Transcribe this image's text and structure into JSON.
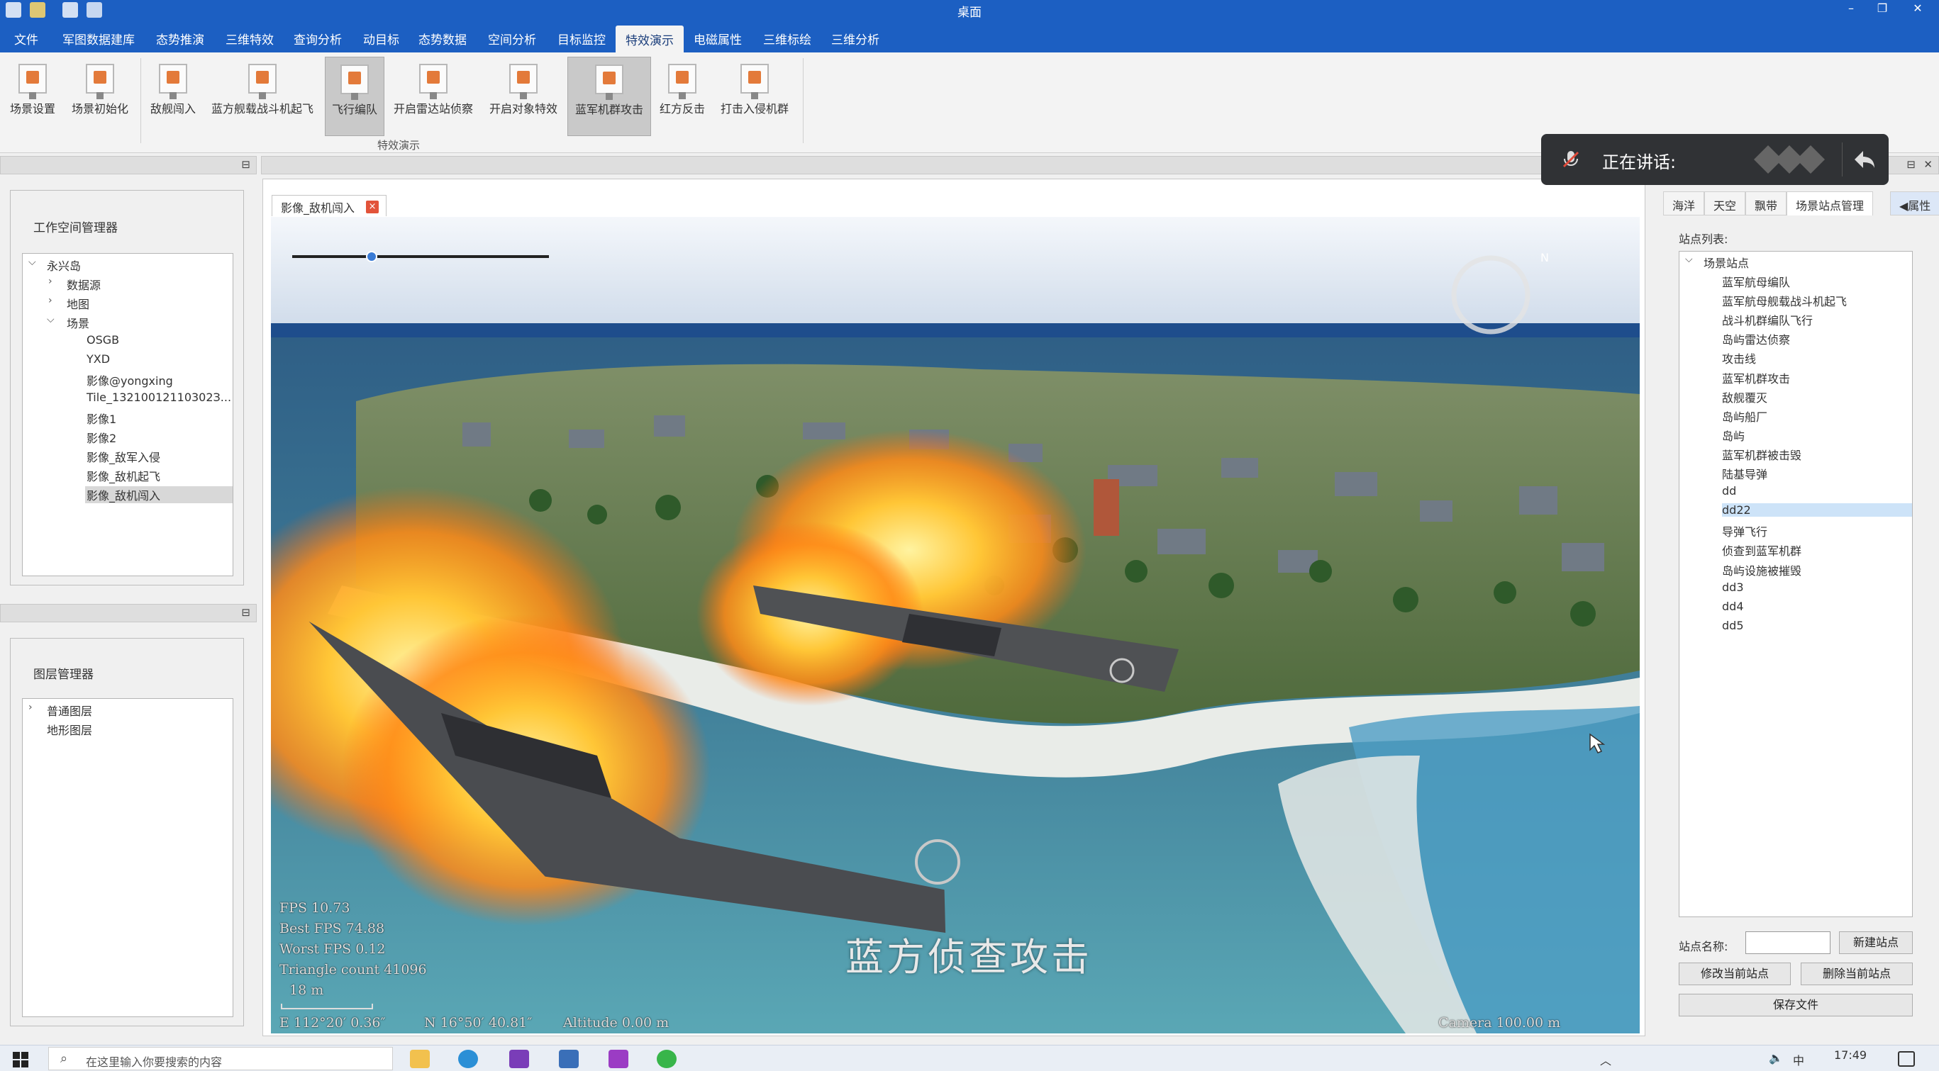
{
  "window": {
    "title": "桌面"
  },
  "menu": {
    "items": [
      "文件",
      "军图数据建库",
      "态势推演",
      "三维特效",
      "查询分析",
      "动目标",
      "态势数据",
      "空间分析",
      "目标监控",
      "特效演示",
      "电磁属性",
      "三维标绘",
      "三维分析"
    ],
    "active": "特效演示"
  },
  "ribbon": {
    "buttons": [
      "场景设置",
      "场景初始化",
      "敌舰闯入",
      "蓝方舰载战斗机起飞",
      "飞行编队",
      "开启雷达站侦察",
      "开启对象特效",
      "蓝军机群攻击",
      "红方反击",
      "打击入侵机群"
    ],
    "group_label": "特效演示"
  },
  "workspace": {
    "title": "工作空间管理器",
    "root": "永兴岛",
    "nodes": [
      "数据源",
      "地图",
      "场景"
    ],
    "scene_children": [
      "OSGB",
      "YXD",
      "影像@yongxing",
      "Tile_13210012110302З...",
      "影像1",
      "影像2",
      "影像_敌军入侵",
      "影像_敌机起飞",
      "影像_敌机闯入"
    ]
  },
  "layers": {
    "title": "图层管理器",
    "nodes": [
      "普通图层",
      "地形图层"
    ]
  },
  "document": {
    "tab_label": "影像_敌机闯入",
    "close_label": "×"
  },
  "scene": {
    "caption": "蓝方侦查攻击",
    "slider_fraction": 0.31,
    "fps": "FPS    10.73",
    "best_fps": "Best FPS   74.88",
    "worst_fps": "Worst FPS   0.12",
    "triangles": "Triangle count  41096",
    "scale": "18 m",
    "coord_e": "E 112°20′ 0.36″",
    "coord_n": "N 16°50′ 40.81″",
    "altitude": "Altitude  0.00 m",
    "camera": "Camera 100.00 m",
    "compass": "N"
  },
  "right_panel": {
    "tabs": [
      "海洋",
      "天空",
      "飘带",
      "场景站点管理",
      "◀属性"
    ],
    "active_tab": "场景站点管理",
    "list_label": "站点列表:",
    "tree_root": "场景站点",
    "stations": [
      "蓝军航母编队",
      "蓝军航母舰载战斗机起飞",
      "战斗机群编队飞行",
      "岛屿雷达侦察",
      "攻击线",
      "蓝军机群攻击",
      "敌舰覆灭",
      "岛屿船厂",
      "岛屿",
      "蓝军机群被击毁",
      "陆基导弹",
      "dd",
      "dd22",
      "导弹飞行",
      "侦查到蓝军机群",
      "岛屿设施被摧毁",
      "dd3",
      "dd4",
      "dd5"
    ],
    "selected_station": "dd22",
    "name_label": "站点名称:",
    "name_value": "",
    "btn_new": "新建站点",
    "btn_modify": "修改当前站点",
    "btn_delete": "删除当前站点",
    "btn_save": "保存文件"
  },
  "talk": {
    "label": "正在讲话:"
  },
  "taskbar": {
    "search_placeholder": "在这里输入你要搜索的内容",
    "ime": "中",
    "time": "17:49"
  }
}
